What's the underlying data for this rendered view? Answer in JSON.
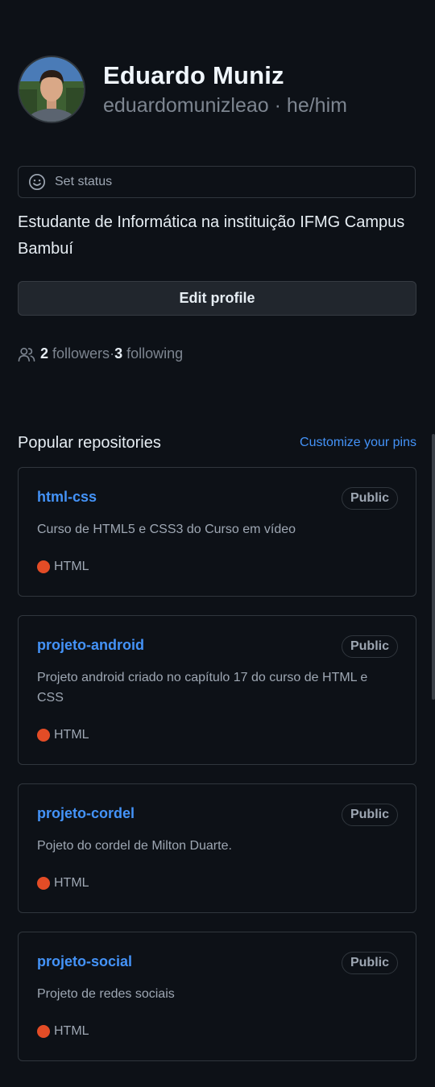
{
  "profile": {
    "name": "Eduardo Muniz",
    "username": "eduardomunizleao",
    "separator": " · ",
    "pronouns": "he/him",
    "bio": "Estudante de Informática na instituição IFMG Campus Bambuí"
  },
  "status": {
    "label": "Set status",
    "icon": "smiley-icon"
  },
  "edit_profile": {
    "label": "Edit profile"
  },
  "follow": {
    "icon": "people-icon",
    "followers_count": "2",
    "followers_label": "followers",
    "dot": " · ",
    "following_count": "3",
    "following_label": "following"
  },
  "popular": {
    "title": "Popular repositories",
    "customize_label": "Customize your pins"
  },
  "repos": [
    {
      "name": "html-css",
      "visibility": "Public",
      "description": "Curso de HTML5 e CSS3 do Curso em vídeo",
      "language": "HTML"
    },
    {
      "name": "projeto-android",
      "visibility": "Public",
      "description": "Projeto android criado no capítulo 17 do curso de HTML e CSS",
      "language": "HTML"
    },
    {
      "name": "projeto-cordel",
      "visibility": "Public",
      "description": "Pojeto do cordel de Milton Duarte.",
      "language": "HTML"
    },
    {
      "name": "projeto-social",
      "visibility": "Public",
      "description": "Projeto de redes sociais",
      "language": "HTML"
    }
  ],
  "colors": {
    "background": "#0d1117",
    "link": "#4493f8",
    "html_language": "#e34c26",
    "border": "#30363d",
    "muted_text": "#7d8590"
  }
}
